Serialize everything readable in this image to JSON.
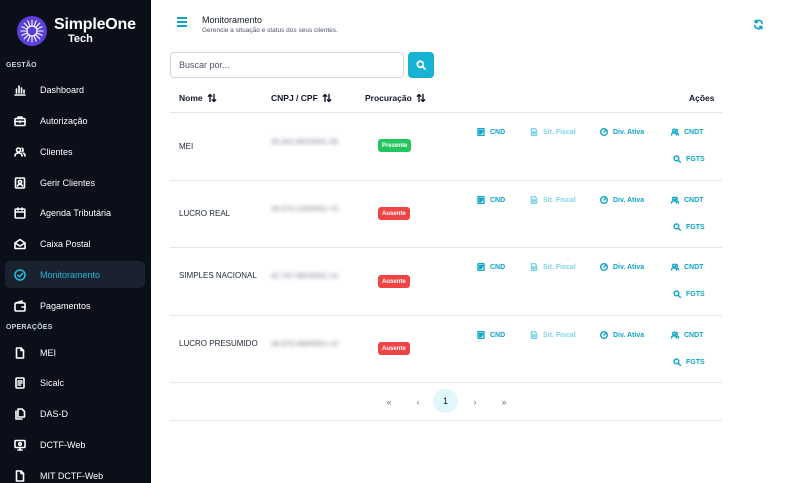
{
  "brand": {
    "name": "SimpleOne",
    "sub": "Tech"
  },
  "sidebar": {
    "sections": [
      {
        "label": "GESTÃO"
      },
      {
        "label": "OPERAÇÕES"
      }
    ],
    "items": [
      {
        "label": "Dashboard",
        "icon": "bar-chart-icon"
      },
      {
        "label": "Autorização",
        "icon": "briefcase-icon"
      },
      {
        "label": "Clientes",
        "icon": "users-icon"
      },
      {
        "label": "Gerir Clientes",
        "icon": "contact-icon"
      },
      {
        "label": "Agenda Tributária",
        "icon": "calendar-icon"
      },
      {
        "label": "Caixa Postal",
        "icon": "mail-icon"
      },
      {
        "label": "Monitoramento",
        "icon": "check-circle-icon",
        "active": true
      },
      {
        "label": "Pagamentos",
        "icon": "wallet-icon"
      },
      {
        "label": "MEI",
        "icon": "file-icon"
      },
      {
        "label": "Sicalc",
        "icon": "document-icon"
      },
      {
        "label": "DAS-D",
        "icon": "files-icon"
      },
      {
        "label": "DCTF-Web",
        "icon": "monitor-icon"
      },
      {
        "label": "MIT DCTF-Web",
        "icon": "file-icon"
      }
    ]
  },
  "header": {
    "title": "Monitoramento",
    "subtitle": "Gerencie a situação e status dos seus clientes."
  },
  "search": {
    "placeholder": "Buscar por..."
  },
  "table": {
    "columns": {
      "nome": "Nome",
      "cnpj": "CNPJ / CPF",
      "procuracao": "Procuração",
      "acoes": "Ações"
    },
    "rows": [
      {
        "nome": "MEI",
        "cnpj": "35.442.802/0001-36",
        "procuracao": "Presente",
        "status": "present"
      },
      {
        "nome": "LUCRO REAL",
        "cnpj": "34.974.216/0001-70",
        "procuracao": "Ausente",
        "status": "absent"
      },
      {
        "nome": "SIMPLES NACIONAL",
        "cnpj": "42.707.882/0001-14",
        "procuracao": "Ausente",
        "status": "absent"
      },
      {
        "nome": "LUCRO PRESUMIDO",
        "cnpj": "49.876.066/0001-10",
        "procuracao": "Ausente",
        "status": "absent"
      }
    ],
    "actions": {
      "cnd": "CND",
      "sit_fiscal": "Sit. Fiscal",
      "div_ativa": "Div. Ativa",
      "cndt": "CNDT",
      "fgts": "FGTS"
    }
  },
  "pagination": {
    "first": "«",
    "prev": "‹",
    "current": "1",
    "next": "›",
    "last": "»"
  },
  "colors": {
    "accent": "#17b2d6",
    "sidebar": "#0b0f1a",
    "present": "#22c55e",
    "absent": "#ef4444"
  }
}
